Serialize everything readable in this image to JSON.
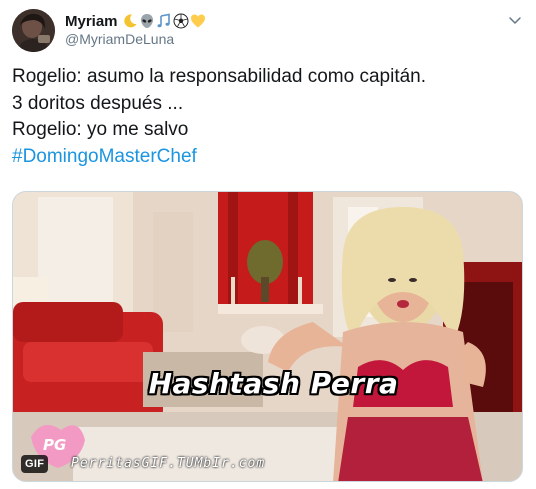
{
  "user": {
    "display_name": "Myriam",
    "handle": "@MyriamDeLuna",
    "name_emojis": [
      "crescent-moon",
      "alien",
      "musical-notes",
      "soccer-ball",
      "yellow-heart"
    ]
  },
  "tweet": {
    "lines": [
      "Rogelio: asumo la responsabilidad como capitán.",
      "3 doritos después ...",
      "Rogelio: yo me salvo"
    ],
    "hashtag": "#DomingoMasterChef"
  },
  "media": {
    "badge": "GIF",
    "caption": "Hashtash Perra",
    "watermark": "PerritasGIF.TUMbIr.com"
  },
  "colors": {
    "text": "#14171a",
    "secondary": "#657786",
    "link": "#1b95e0",
    "border": "#ccd6dd"
  }
}
